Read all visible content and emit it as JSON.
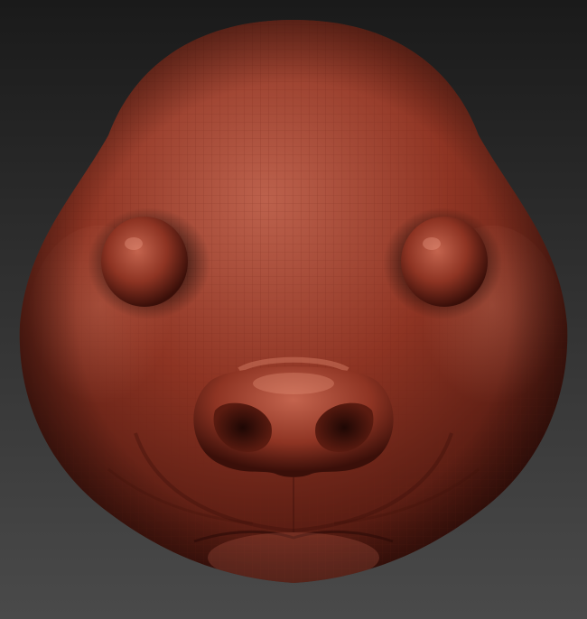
{
  "scene": {
    "background_top": "#1a1a1a",
    "background_bottom": "#4a4a4a",
    "material_base": "#8e3423",
    "material_light": "#c4644e",
    "material_shadow": "#3a0f09",
    "wireframe_color": "#6e2214"
  }
}
